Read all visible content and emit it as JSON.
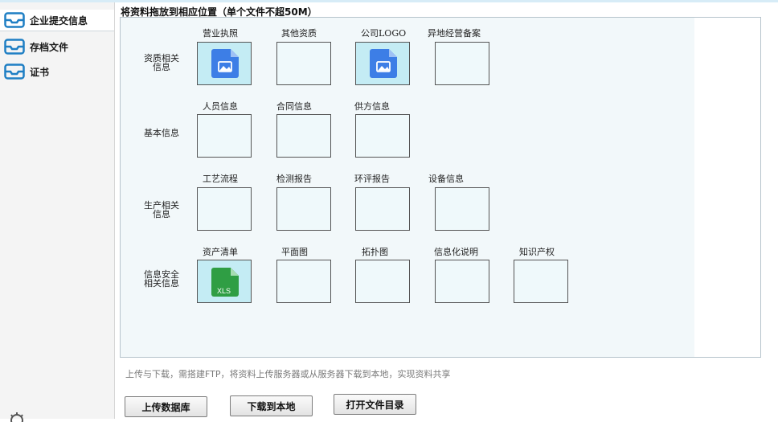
{
  "sidebar": {
    "items": [
      {
        "label": "企业提交信息",
        "icon": "inbox-icon",
        "active": true
      },
      {
        "label": "存档文件",
        "icon": "inbox-icon",
        "active": false
      },
      {
        "label": "证书",
        "icon": "inbox-icon",
        "active": false
      }
    ],
    "icon_color": "#1f7fc4"
  },
  "header": {
    "title": "将资料拖放到相应位置（单个文件不超50M）"
  },
  "sections": [
    {
      "label": "资质相关\n信息",
      "slots": [
        {
          "label": "营业执照",
          "file": "image-file-icon"
        },
        {
          "label": "其他资质",
          "file": ""
        },
        {
          "label": "公司LOGO",
          "file": "image-file-icon"
        },
        {
          "label": "异地经营备案",
          "file": ""
        }
      ]
    },
    {
      "label": "基本信息",
      "slots": [
        {
          "label": "人员信息",
          "file": ""
        },
        {
          "label": "合同信息",
          "file": ""
        },
        {
          "label": "供方信息",
          "file": ""
        }
      ]
    },
    {
      "label": "生产相关\n信息",
      "slots": [
        {
          "label": "工艺流程",
          "file": ""
        },
        {
          "label": "检测报告",
          "file": ""
        },
        {
          "label": "环评报告",
          "file": ""
        },
        {
          "label": "设备信息",
          "file": ""
        }
      ]
    },
    {
      "label": "信息安全\n相关信息",
      "slots": [
        {
          "label": "资产清单",
          "file": "xls-file-icon",
          "file_text": "XLS"
        },
        {
          "label": "平面图",
          "file": ""
        },
        {
          "label": "拓扑图",
          "file": ""
        },
        {
          "label": "信息化说明",
          "file": ""
        },
        {
          "label": "知识产权",
          "file": ""
        }
      ]
    }
  ],
  "footer": {
    "note": "上传与下载，需搭建FTP，将资料上传服务器或从服务器下载到本地，实现资料共享",
    "buttons": {
      "upload": "上传数据库",
      "download": "下载到本地",
      "open_dir": "打开文件目录"
    }
  },
  "colors": {
    "slot_empty": "#eff9fb",
    "slot_filled": "#c4ecf4",
    "image_file": "#3d7ee6",
    "xls_file": "#2f9e44"
  }
}
